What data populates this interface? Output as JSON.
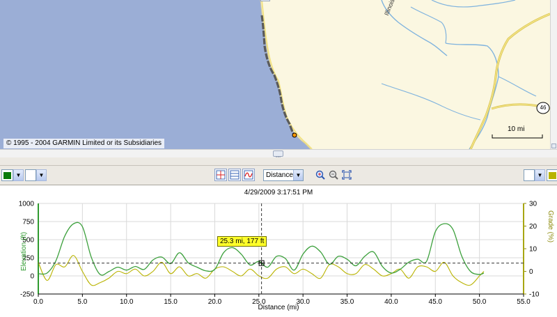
{
  "map": {
    "copyright": "© 1995 - 2004 GARMIN Limited or its Subsidiaries",
    "scale_label": "10 mi",
    "road_shield": "46",
    "river_label": "Illinois River",
    "colors": {
      "ocean": "#9baed6",
      "land": "#fbf7e1",
      "river": "#7fb3de",
      "road": "#e7d36a",
      "track": "#555555"
    }
  },
  "toolbar": {
    "left_series_color": "#0a7a0a",
    "right_series_color": "#b9b300",
    "x_axis_mode": "Distance",
    "buttons": [
      "crosshair-button",
      "split-view-button",
      "smooth-curve-button"
    ],
    "zoom_in": "zoom-in",
    "zoom_out": "zoom-out",
    "zoom_fit": "zoom-extents"
  },
  "profile": {
    "timestamp": "4/29/2009 3:17:51 PM",
    "cursor_tooltip": "25.3 mi, 177 ft"
  },
  "chart_data": {
    "type": "line",
    "xlabel": "Distance (mi)",
    "ylabel_left": "Elevation (ft)",
    "ylabel_right": "Grade (%)",
    "xlim": [
      0,
      55
    ],
    "ylim_left": [
      -250,
      1000
    ],
    "ylim_right": [
      -10,
      30
    ],
    "x_ticks": [
      "0.0",
      "5.0",
      "10.0",
      "15.0",
      "20.0",
      "25.0",
      "30.0",
      "35.0",
      "40.0",
      "45.0",
      "50.0",
      "55.0"
    ],
    "y_left_ticks": [
      "1000",
      "750",
      "500",
      "250",
      "0",
      "-250"
    ],
    "y_right_ticks": [
      "30",
      "20",
      "10",
      "0",
      "-10"
    ],
    "grid": true,
    "cursor": {
      "x": 25.3,
      "elevation": 177
    },
    "series": [
      {
        "name": "Elevation (ft)",
        "color": "#3ca03c",
        "x": [
          0,
          1,
          2,
          3,
          4,
          5,
          6,
          7,
          8,
          9,
          10,
          11,
          12,
          13,
          14,
          15,
          16,
          17,
          18,
          19,
          20,
          21,
          22,
          23,
          24,
          25,
          26,
          27,
          28,
          29,
          30,
          31,
          32,
          33,
          34,
          35,
          36,
          37,
          38,
          39,
          40,
          41,
          42,
          43,
          44,
          45,
          46,
          47,
          48,
          49,
          50,
          50.5
        ],
        "y": [
          30,
          40,
          210,
          550,
          720,
          680,
          260,
          20,
          60,
          120,
          80,
          130,
          90,
          220,
          260,
          170,
          320,
          180,
          120,
          70,
          90,
          320,
          390,
          300,
          150,
          200,
          120,
          270,
          240,
          80,
          300,
          410,
          330,
          160,
          270,
          230,
          140,
          270,
          330,
          130,
          40,
          90,
          190,
          230,
          200,
          610,
          720,
          640,
          270,
          60,
          20,
          40
        ]
      },
      {
        "name": "Grade (%)",
        "color": "#b9b300",
        "x": [
          0,
          1,
          2,
          3,
          4,
          5,
          6,
          7,
          8,
          9,
          10,
          11,
          12,
          13,
          14,
          15,
          16,
          17,
          18,
          19,
          20,
          21,
          22,
          23,
          24,
          25,
          26,
          27,
          28,
          29,
          30,
          31,
          32,
          33,
          34,
          35,
          36,
          37,
          38,
          39,
          40,
          41,
          42,
          43,
          44,
          45,
          46,
          47,
          48,
          49,
          50,
          50.5
        ],
        "y": [
          4,
          -4,
          3,
          2,
          7,
          0,
          -6,
          -5,
          -3,
          0,
          -1,
          1,
          -2,
          0,
          4,
          -1,
          2,
          -2,
          -1,
          -3,
          1,
          2,
          0,
          -2,
          1,
          -2,
          -3,
          1,
          2,
          -1,
          1,
          -1,
          -3,
          3,
          2,
          -1,
          -1,
          3,
          1,
          -2,
          -1,
          1,
          -3,
          2,
          2,
          0,
          4,
          -2,
          -5,
          -6,
          -2,
          0
        ]
      }
    ]
  }
}
